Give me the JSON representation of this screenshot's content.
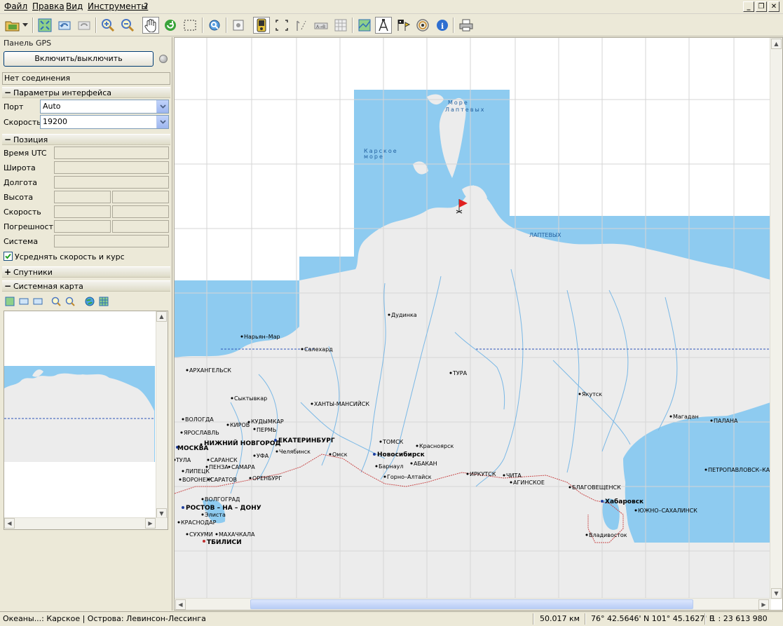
{
  "menu": {
    "items": [
      "Файл",
      "Правка",
      "Вид",
      "Инструменты",
      "?"
    ]
  },
  "toolbar": {
    "buttons": [
      "open-icon",
      "dropdown-arrow-icon",
      "zoom-extent-icon",
      "back-icon",
      "forward-icon",
      "zoom-in-icon",
      "zoom-out-icon",
      "pan-hand-icon",
      "refresh-icon",
      "select-rect-icon",
      "find-icon",
      "center-icon",
      "gps-device-icon",
      "frame-icon",
      "measure-icon",
      "route-icon",
      "grid-icon",
      "layers-icon",
      "compass-tool-icon",
      "flags-icon",
      "signal-icon",
      "info-icon",
      "print-icon"
    ]
  },
  "gps_panel": {
    "title": "Панель GPS",
    "toggle_label": "Включить/выключить",
    "connection_status": "Нет соединения",
    "interface_section": "Параметры интерфейса",
    "port_label": "Порт",
    "port_value": "Auto",
    "speed_label": "Скорость",
    "speed_value": "19200",
    "position_section": "Позиция",
    "position_rows": [
      "Время UTC",
      "Широта",
      "Долгота",
      "Высота",
      "Скорость",
      "Погрешность",
      "Система"
    ],
    "average_label": "Усреднять скорость и курс",
    "average_checked": true,
    "satellites_section": "Спутники",
    "sysmap_section": "Системная карта"
  },
  "map": {
    "seas": {
      "laptev_1": "Море",
      "laptev_2": "Лаптевых",
      "kara_1": "Карское",
      "kara_2": "море",
      "laptev_short": "ЛАПТЕВЫХ"
    },
    "cities": {
      "dudinka": "Дудинка",
      "naryan_mar": "Нарьян–Мар",
      "salekhard": "Салехард",
      "arkhangelsk": "АРХАНГЕЛЬСК",
      "tura": "ТУРА",
      "syktyvkar": "Сыктывкар",
      "khanty": "ХАНТЫ-МАНСИЙСК",
      "yakutsk": "Якутск",
      "magadan": "Магадан",
      "palana": "ПАЛАНА",
      "vologda": "ВОЛОГДА",
      "kudymkar": "КУДЫМКАР",
      "kirov": "КИРОВ",
      "perm": "ПЕРМЬ",
      "yaroslavl": "ЯРОСЛАВЛЬ",
      "ekaterinburg": "ЕКАТЕРИНБУРГ",
      "tomsk": "ТОМСК",
      "krasnoyarsk": "Красноярск",
      "moskva": "МОСКВА",
      "nnovgorod": "НИЖНИЙ НОВГОРОД",
      "chelyabinsk": "Челябинск",
      "omsk": "Омск",
      "novosibirsk": "Новосибирск",
      "ufa": "УФА",
      "tula": "ТУЛА",
      "saransk": "САРАНСК",
      "barnaul": "Барнаул",
      "abakan": "АБАКАН",
      "petropavlovsk": "ПЕТРОПАВЛОВСК–КАМ",
      "lipetsk": "ЛИПЕЦК",
      "penza": "ПЕНЗА",
      "samara": "САМАРА",
      "irkutsk": "ИРКУТСК",
      "chita": "ЧИТА",
      "voronezh": "ВОРОНЕЖ",
      "saratov": "САРАТОВ",
      "orenburg": "ОРЕНБУРГ",
      "gorno_altaysk": "Горно–Алтайск",
      "aginskoe": "АГИНСКОЕ",
      "blagoveshchensk": "БЛАГОВЕЩЕНСК",
      "volgograd": "ВОЛГОГРАД",
      "khabarovsk": "Хабаровск",
      "rostov": "РОСТОВ – НА – ДОНУ",
      "elista": "Элиста",
      "yuzhno": "ЮЖНО–САХАЛИНСК",
      "krasnodar": "КРАСНОДАР",
      "sukhumi": "СУХУМИ",
      "makhachkala": "МАХАЧКАЛА",
      "vladivostok": "Владивосток",
      "tbilisi": "ТБИЛИСИ"
    }
  },
  "statusbar": {
    "place": "Океаны...: Карское | Острова: Левинсон-Лессинга",
    "distance": "50.017  км",
    "coords": "76° 42.5646' N  101° 45.1627' E",
    "scale": "1 : 23 613 980"
  },
  "colors": {
    "water": "#8ecbf0",
    "land": "#ececec",
    "grid": "#d6d6d6",
    "border": "#c94c4c",
    "panel": "#ece9d8"
  }
}
